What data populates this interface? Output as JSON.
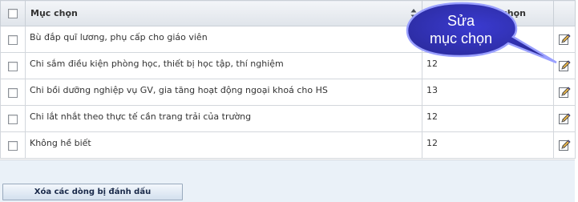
{
  "table": {
    "header": {
      "select_all": false,
      "name_column": "Mục chọn",
      "value_column_visible": "chọn"
    },
    "rows": [
      {
        "selected": false,
        "name": "Bù đắp quĩ lương, phụ cấp cho giáo viên",
        "value": ""
      },
      {
        "selected": false,
        "name": "Chi sắm điều kiện phòng học, thiết bị học tập, thí nghiệm",
        "value": "12"
      },
      {
        "selected": false,
        "name": "Chi bồi dưỡng nghiệp vụ GV, gia tăng hoạt động ngoại khoá cho HS",
        "value": "13"
      },
      {
        "selected": false,
        "name": "Chi lắt nhắt theo thực tế cần trang trải của trường",
        "value": "12"
      },
      {
        "selected": false,
        "name": "Không hề biết",
        "value": "12"
      }
    ]
  },
  "actions": {
    "delete_selected_label": "Xóa các dòng bị đánh dấu"
  },
  "callout": {
    "line1": "Sửa",
    "line2": "mục chọn",
    "fill_color": "#3636b8",
    "border_color": "#9aa0ff"
  },
  "icons": {
    "sort": "sort-arrows-icon",
    "edit": "edit-pencil-icon",
    "checkbox": "checkbox-icon"
  }
}
